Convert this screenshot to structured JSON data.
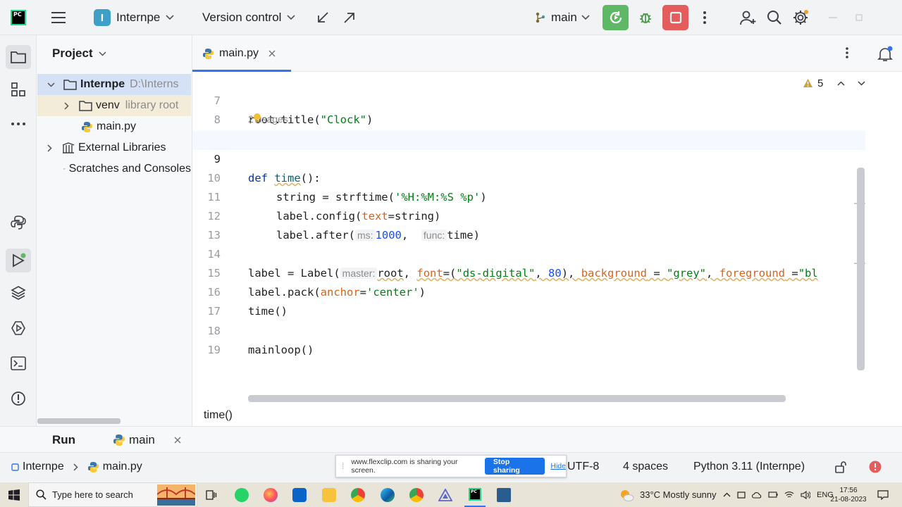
{
  "titlebar": {
    "project_badge": "I",
    "project_name": "Internpe",
    "vcs_label": "Version control",
    "branch": "main"
  },
  "project_panel": {
    "title": "Project",
    "items": [
      {
        "label": "Internpe",
        "hint": "D:\\Interns"
      },
      {
        "label": "venv",
        "hint": "library root"
      },
      {
        "label": "main.py",
        "hint": ""
      },
      {
        "label": "External Libraries",
        "hint": ""
      },
      {
        "label": "Scratches and Consoles",
        "hint": ""
      }
    ]
  },
  "editor": {
    "tab_label": "main.py",
    "warnings_count": "5",
    "usages_hint": "2 usages",
    "line_numbers": [
      "7",
      "8",
      "9",
      "10",
      "11",
      "12",
      "13",
      "14",
      "15",
      "16",
      "17",
      "18",
      "19"
    ],
    "tokens": {
      "l7_a": "root.title(",
      "l7_b": "\"Clock\"",
      "l7_c": ")",
      "l9_a": "def",
      "l9_b": "time",
      "l9_c": "():",
      "l10_a": "string = strftime(",
      "l10_b": "'%H:%M:%S %p'",
      "l10_c": ")",
      "l11_a": "label.config(",
      "l11_b": "text",
      "l11_c": "=string)",
      "l12_a": "label.after(",
      "l12_h1": "ms:",
      "l12_b": "1000",
      "l12_c": ",",
      "l12_h2": "func:",
      "l12_d": "time)",
      "l14_a": "label = Label(",
      "l14_h1": "master:",
      "l14_b": "root",
      "l14_c": ",",
      "l14_d": "font",
      "l14_e": "=(",
      "l14_f": "\"ds-digital\"",
      "l14_g": ", ",
      "l14_h": "80",
      "l14_i": "), ",
      "l14_j": "background",
      "l14_k": " = ",
      "l14_l": "\"grey\"",
      "l14_m": ", ",
      "l14_n": "foreground",
      "l14_o": " =",
      "l14_p": "\"bl",
      "l15_a": "label.pack(",
      "l15_b": "anchor",
      "l15_c": "=",
      "l15_d": "'center'",
      "l15_e": ")",
      "l16_a": "time()",
      "l18_a": "mainloop()"
    },
    "breadcrumb": "time()"
  },
  "run_bar": {
    "label": "Run",
    "config": "main"
  },
  "statusbar": {
    "project": "Internpe",
    "file": "main.py",
    "encoding": "UTF-8",
    "indent": "4 spaces",
    "interpreter": "Python 3.11 (Internpe)"
  },
  "sharing": {
    "message": "www.flexclip.com is sharing your screen.",
    "stop": "Stop sharing",
    "hide": "Hide"
  },
  "taskbar": {
    "search_placeholder": "Type here to search",
    "weather": "33°C  Mostly sunny",
    "lang": "ENG",
    "time": "17:56",
    "date": "21-08-2023"
  },
  "colors": {
    "accent": "#3574f0",
    "run_green": "#5fb865",
    "stop_red": "#e55c5c"
  }
}
